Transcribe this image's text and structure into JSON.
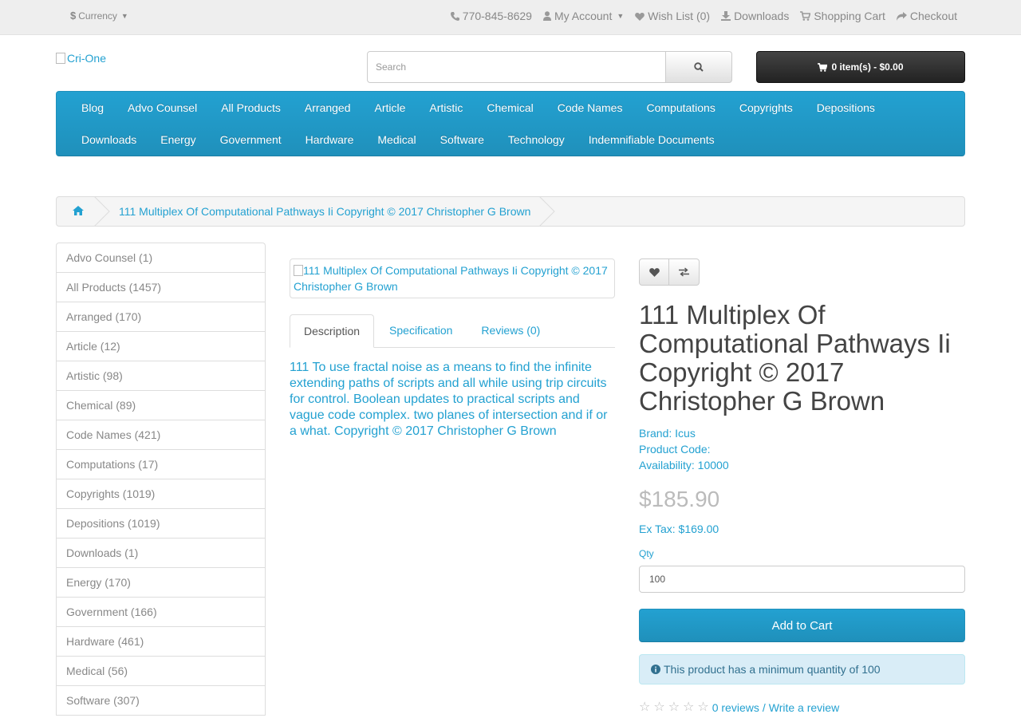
{
  "topbar": {
    "currency_symbol": "$",
    "currency_label": "Currency",
    "phone": "770-845-8629",
    "my_account": "My Account",
    "wishlist": "Wish List (0)",
    "downloads": "Downloads",
    "shopping_cart": "Shopping Cart",
    "checkout": "Checkout"
  },
  "header": {
    "logo_alt": "Cri-One",
    "search_placeholder": "Search",
    "cart_summary": "0 item(s) - $0.00"
  },
  "menu": {
    "row1": [
      "Blog",
      "Advo Counsel",
      "All Products",
      "Arranged",
      "Article",
      "Artistic",
      "Chemical",
      "Code Names",
      "Computations",
      "Copyrights",
      "Depositions"
    ],
    "row2": [
      "Downloads",
      "Energy",
      "Government",
      "Hardware",
      "Medical",
      "Software",
      "Technology",
      "Indemnifiable Documents"
    ]
  },
  "breadcrumb": {
    "current": "111 Multiplex Of Computational Pathways Ii Copyright © 2017 Christopher G Brown"
  },
  "sidebar": {
    "items": [
      "Advo Counsel (1)",
      "All Products (1457)",
      "Arranged (170)",
      "Article (12)",
      "Artistic (98)",
      "Chemical (89)",
      "Code Names (421)",
      "Computations (17)",
      "Copyrights (1019)",
      "Depositions (1019)",
      "Downloads (1)",
      "Energy (170)",
      "Government (166)",
      "Hardware (461)",
      "Medical (56)",
      "Software (307)"
    ]
  },
  "product": {
    "image_alt": "111 Multiplex Of Computational Pathways Ii Copyright © 2017 Christopher G Brown",
    "tabs": [
      "Description",
      "Specification",
      "Reviews (0)"
    ],
    "description": "111 To use fractal noise as a means to find the infinite extending paths of scripts and all while using trip circuits for control. Boolean updates to practical scripts and vague code complex. two planes of intersection and if or a what. Copyright © 2017 Christopher G Brown",
    "title": "111 Multiplex Of Computational Pathways Ii Copyright © 2017 Christopher G Brown",
    "brand_label": "Brand:",
    "brand": "Icus",
    "product_code_label": "Product Code:",
    "availability_label": "Availability:",
    "availability": "10000",
    "price": "$185.90",
    "ex_tax": "Ex Tax: $169.00",
    "qty_label": "Qty",
    "qty_value": "100",
    "add_to_cart": "Add to Cart",
    "min_qty_notice": "This product has a minimum quantity of 100",
    "reviews_link": "0 reviews",
    "review_separator": "/",
    "write_review": "Write a review",
    "rating_stars": 0
  },
  "colors": {
    "accent": "#23a1d1",
    "topbar_bg": "#eeeeee",
    "cart_button": "#303030",
    "alert_bg": "#d9edf7"
  }
}
